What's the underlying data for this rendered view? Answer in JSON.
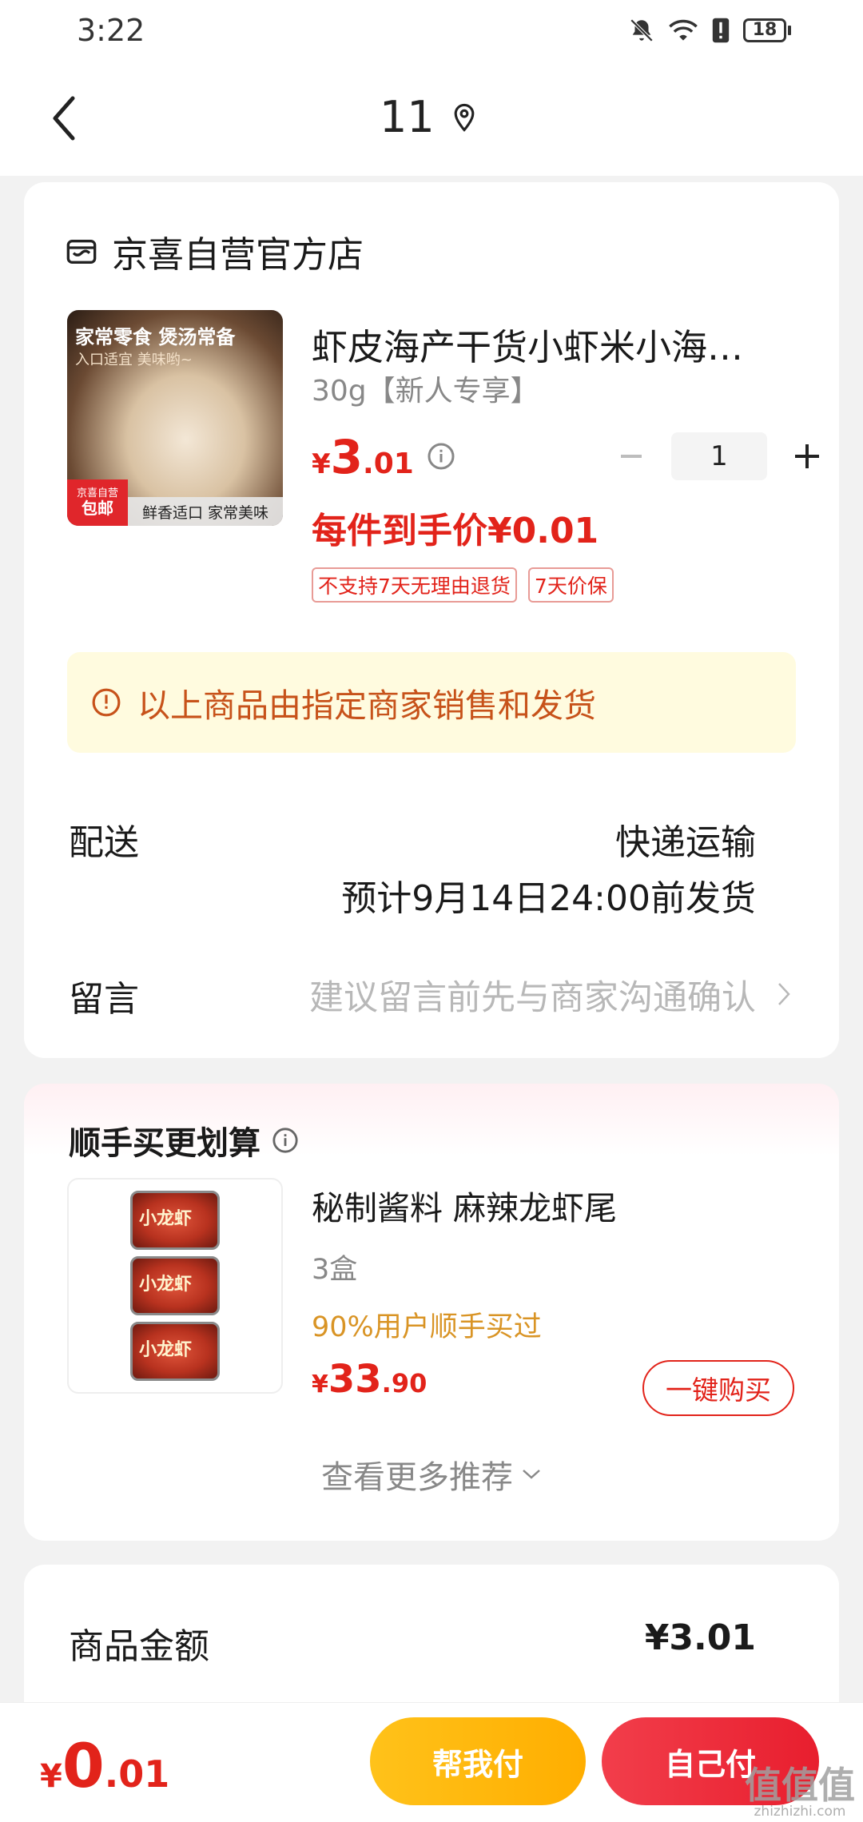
{
  "status_bar": {
    "time": "3:22",
    "battery": "18",
    "icons": [
      "mute-icon",
      "wifi-icon",
      "alert-icon",
      "battery-icon"
    ]
  },
  "nav": {
    "title": "11",
    "back_icon": "chevron-left-icon",
    "location_icon": "location-pin-icon"
  },
  "order": {
    "shop_name": "京喜自营官方店",
    "product": {
      "image_text_1": "家常零食 煲汤常备",
      "image_text_2": "入口适宜 美味哟~",
      "image_badge_small": "京喜自营",
      "image_badge": "包邮",
      "image_bar": "鲜香适口 家常美味",
      "title": "虾皮海产干货小虾米小海…",
      "spec": "30g【新人专享】",
      "price_currency": "¥",
      "price_int": "3",
      "price_dec": ".01",
      "quantity": "1",
      "unit_price": "每件到手价¥0.01",
      "tags": [
        "不支持7天无理由退货",
        "7天价保"
      ]
    },
    "notice": "以上商品由指定商家销售和发货",
    "delivery_label": "配送",
    "delivery_method": "快递运输",
    "delivery_date": "预计9月14日24:00前发货",
    "message_label": "留言",
    "message_placeholder": "建议留言前先与商家沟通确认"
  },
  "recommend": {
    "title": "顺手买更划算",
    "item": {
      "box_text": "小龙虾",
      "name": "秘制酱料 麻辣龙虾尾",
      "spec": "3盒",
      "popularity": "90%用户顺手买过",
      "price_currency": "¥",
      "price_int": "33",
      "price_dec": ".90",
      "buy_label": "一键购买"
    },
    "more_label": "查看更多推荐"
  },
  "summary": {
    "label": "商品金额",
    "value": "¥3.01"
  },
  "footer": {
    "total_currency": "¥",
    "total_int": "0",
    "total_dec": ".01",
    "help_pay_label": "帮我付",
    "self_pay_label": "自己付",
    "watermark": "值值值",
    "watermark_url": "zhizhizhi.com"
  },
  "colors": {
    "price_red": "#e2231a",
    "notice_bg": "#fffbdf",
    "notice_text": "#c7521a",
    "help_btn": "#ffb300",
    "self_btn": "#ef2c3c"
  }
}
